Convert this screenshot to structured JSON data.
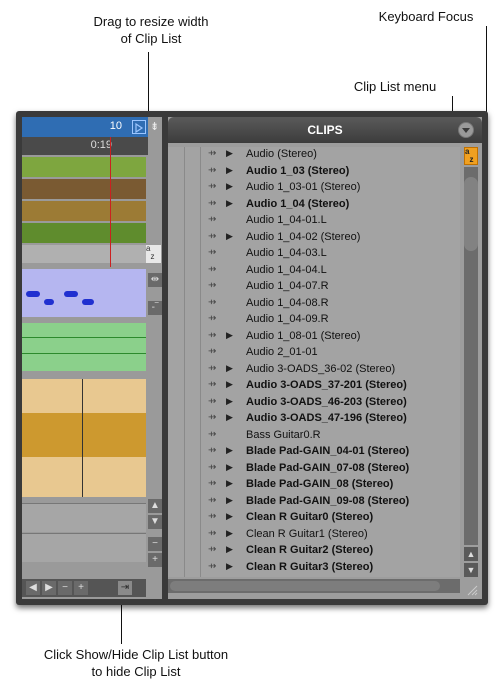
{
  "callouts": {
    "drag_resize": "Drag to resize width\nof Clip List",
    "keyboard_focus": "Keyboard Focus",
    "clip_list_menu": "Clip List menu",
    "show_hide": "Click Show/Hide Clip List button\nto hide Clip List"
  },
  "edit": {
    "counter": "10",
    "time": "0:19"
  },
  "clips": {
    "title": "CLIPS",
    "az_label": "a z",
    "items": [
      {
        "name": "Audio (Stereo)",
        "bold": false,
        "expandable": true
      },
      {
        "name": "Audio 1_03 (Stereo)",
        "bold": true,
        "expandable": true
      },
      {
        "name": "Audio 1_03-01 (Stereo)",
        "bold": false,
        "expandable": true
      },
      {
        "name": "Audio 1_04 (Stereo)",
        "bold": true,
        "expandable": true
      },
      {
        "name": "Audio 1_04-01.L",
        "bold": false,
        "expandable": false
      },
      {
        "name": "Audio 1_04-02 (Stereo)",
        "bold": false,
        "expandable": true
      },
      {
        "name": "Audio 1_04-03.L",
        "bold": false,
        "expandable": false
      },
      {
        "name": "Audio 1_04-04.L",
        "bold": false,
        "expandable": false
      },
      {
        "name": "Audio 1_04-07.R",
        "bold": false,
        "expandable": false
      },
      {
        "name": "Audio 1_04-08.R",
        "bold": false,
        "expandable": false
      },
      {
        "name": "Audio 1_04-09.R",
        "bold": false,
        "expandable": false
      },
      {
        "name": "Audio 1_08-01 (Stereo)",
        "bold": false,
        "expandable": true
      },
      {
        "name": "Audio 2_01-01",
        "bold": false,
        "expandable": false
      },
      {
        "name": "Audio 3-OADS_36-02 (Stereo)",
        "bold": false,
        "expandable": true
      },
      {
        "name": "Audio 3-OADS_37-201 (Stereo)",
        "bold": true,
        "expandable": true
      },
      {
        "name": "Audio 3-OADS_46-203 (Stereo)",
        "bold": true,
        "expandable": true
      },
      {
        "name": "Audio 3-OADS_47-196 (Stereo)",
        "bold": true,
        "expandable": true
      },
      {
        "name": "Bass Guitar0.R",
        "bold": false,
        "expandable": false
      },
      {
        "name": "Blade Pad-GAIN_04-01 (Stereo)",
        "bold": true,
        "expandable": true
      },
      {
        "name": "Blade Pad-GAIN_07-08 (Stereo)",
        "bold": true,
        "expandable": true
      },
      {
        "name": "Blade Pad-GAIN_08 (Stereo)",
        "bold": true,
        "expandable": true
      },
      {
        "name": "Blade Pad-GAIN_09-08 (Stereo)",
        "bold": true,
        "expandable": true
      },
      {
        "name": "Clean R Guitar0 (Stereo)",
        "bold": true,
        "expandable": true
      },
      {
        "name": "Clean R Guitar1 (Stereo)",
        "bold": false,
        "expandable": true
      },
      {
        "name": "Clean R Guitar2 (Stereo)",
        "bold": true,
        "expandable": true
      },
      {
        "name": "Clean R Guitar3 (Stereo)",
        "bold": true,
        "expandable": true
      }
    ]
  },
  "colors": {
    "counter_blue": "#2f6db3",
    "focus_orange": "#f0a020",
    "track_green": "#7ea63f",
    "track_brown": "#7a5a32",
    "track_gold": "#9c7b35",
    "track_purple": "#b5b6f0",
    "track_mint": "#8bd08b",
    "track_tan": "#e8c890",
    "playhead_red": "#cc2020"
  },
  "icons": {
    "drag_grip": "grip-icon",
    "expand": "expand-triangle-icon",
    "menu": "menu-circle-icon",
    "show_hide": "show-hide-clip-list-icon"
  }
}
